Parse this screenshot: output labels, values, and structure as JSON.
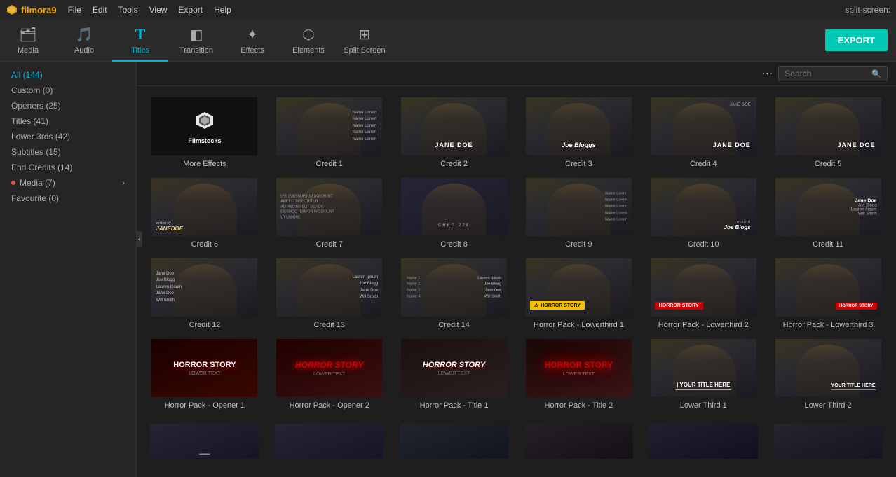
{
  "app": {
    "name": "filmora9",
    "split_screen_label": "split-screen:"
  },
  "menu": {
    "items": [
      "File",
      "Edit",
      "Tools",
      "View",
      "Export",
      "Help"
    ]
  },
  "toolbar": {
    "items": [
      {
        "id": "media",
        "label": "Media",
        "icon": "🗂"
      },
      {
        "id": "audio",
        "label": "Audio",
        "icon": "🎵"
      },
      {
        "id": "titles",
        "label": "Titles",
        "icon": "T",
        "active": true
      },
      {
        "id": "transition",
        "label": "Transition",
        "icon": "◧"
      },
      {
        "id": "effects",
        "label": "Effects",
        "icon": "✦"
      },
      {
        "id": "elements",
        "label": "Elements",
        "icon": "⬡"
      },
      {
        "id": "split_screen",
        "label": "Split Screen",
        "icon": "⊞"
      }
    ],
    "export_label": "EXPORT"
  },
  "sidebar": {
    "items": [
      {
        "label": "All (144)",
        "active": true,
        "dot": false
      },
      {
        "label": "Custom (0)",
        "dot": false
      },
      {
        "label": "Openers (25)",
        "dot": false
      },
      {
        "label": "Titles (41)",
        "dot": false
      },
      {
        "label": "Lower 3rds (42)",
        "dot": false
      },
      {
        "label": "Subtitles (15)",
        "dot": false
      },
      {
        "label": "End Credits (14)",
        "dot": false
      },
      {
        "label": "Media (7)",
        "dot": true,
        "arrow": true
      },
      {
        "label": "Favourite (0)",
        "dot": false
      }
    ]
  },
  "search": {
    "placeholder": "Search"
  },
  "grid_items": [
    {
      "id": "more-effects",
      "label": "More Effects",
      "type": "filmstocks"
    },
    {
      "id": "credit-1",
      "label": "Credit 1",
      "type": "credits_list"
    },
    {
      "id": "credit-2",
      "label": "Credit 2",
      "type": "credit_name",
      "name": "JANE DOE"
    },
    {
      "id": "credit-3",
      "label": "Credit 3",
      "type": "credit_name",
      "name": "Joe Bloggs"
    },
    {
      "id": "credit-4",
      "label": "Credit 4",
      "type": "credit_name2",
      "name": "JANE DOE"
    },
    {
      "id": "credit-5",
      "label": "Credit 5",
      "type": "credit_name2",
      "name": "JANE DOE"
    },
    {
      "id": "credit-6",
      "label": "Credit 6",
      "type": "credit_name3",
      "name": "JANEDOE"
    },
    {
      "id": "credit-7",
      "label": "Credit 7",
      "type": "credits_text"
    },
    {
      "id": "credit-8",
      "label": "Credit 8",
      "type": "credit_single",
      "name": "CREG 228"
    },
    {
      "id": "credit-9",
      "label": "Credit 9",
      "type": "credits_multi"
    },
    {
      "id": "credit-10",
      "label": "Credit 10",
      "type": "credit_name4",
      "name": "Joe Blogs"
    },
    {
      "id": "credit-11",
      "label": "Credit 11",
      "type": "credits_multi2"
    },
    {
      "id": "credit-12",
      "label": "Credit 12",
      "type": "credits_col"
    },
    {
      "id": "credit-13",
      "label": "Credit 13",
      "type": "credits_col2"
    },
    {
      "id": "credit-14",
      "label": "Credit 14",
      "type": "credits_col3"
    },
    {
      "id": "horror-1",
      "label": "Horror Pack - Lowerthird 1",
      "type": "horror_lower1"
    },
    {
      "id": "horror-2",
      "label": "Horror Pack - Lowerthird 2",
      "type": "horror_lower2"
    },
    {
      "id": "horror-3",
      "label": "Horror Pack - Lowerthird 3",
      "type": "horror_lower3"
    },
    {
      "id": "horror-opener-1",
      "label": "Horror Pack - Opener 1",
      "type": "horror_opener1"
    },
    {
      "id": "horror-opener-2",
      "label": "Horror Pack - Opener 2",
      "type": "horror_opener2"
    },
    {
      "id": "horror-title-1",
      "label": "Horror Pack - Title 1",
      "type": "horror_title1"
    },
    {
      "id": "horror-title-2",
      "label": "Horror Pack - Title 2",
      "type": "horror_title2"
    },
    {
      "id": "lower-third-1",
      "label": "Lower Third 1",
      "type": "lower_third1"
    },
    {
      "id": "lower-third-2",
      "label": "Lower Third 2",
      "type": "lower_third2"
    }
  ],
  "colors": {
    "active": "#00b4d8",
    "export_bg": "#00c8b4",
    "horror_yellow": "#f5c000",
    "horror_red": "#cc0000"
  }
}
